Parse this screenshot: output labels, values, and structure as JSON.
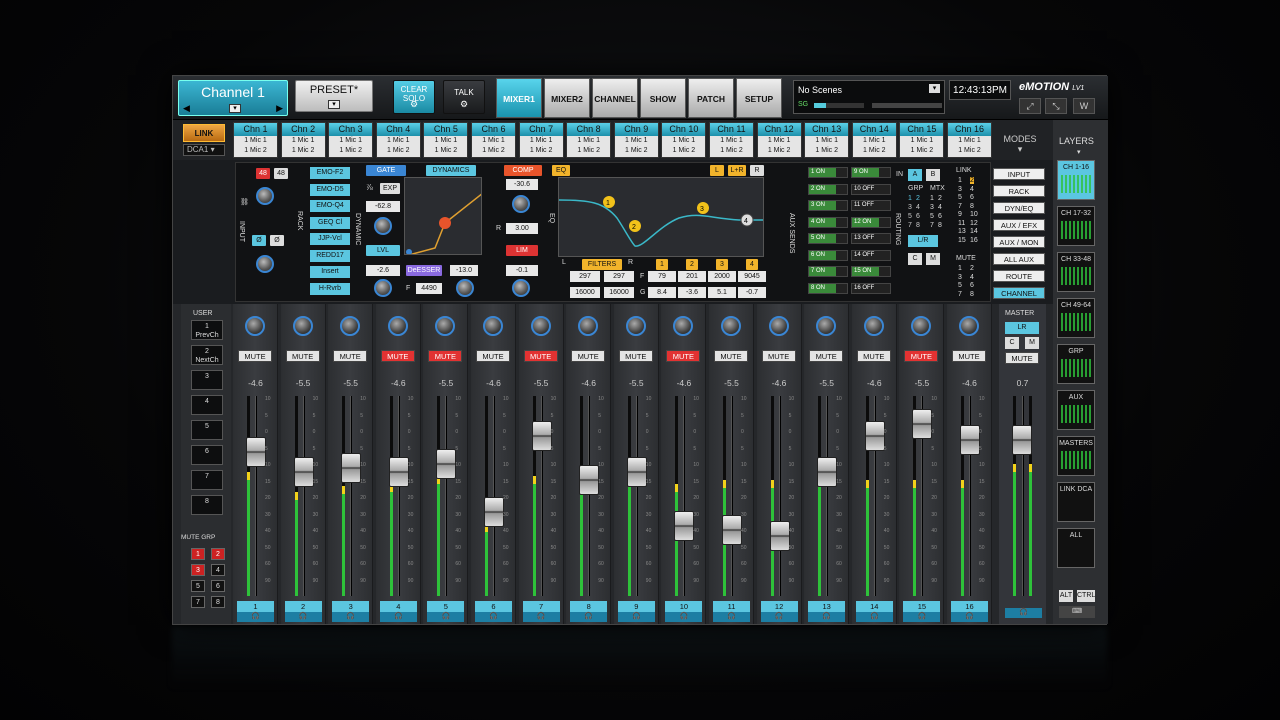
{
  "topbar": {
    "channel_name": "Channel 1",
    "preset": "PRESET*",
    "clear_solo": "CLEAR SOLO",
    "talk": "TALK",
    "tabs": [
      "MIXER1",
      "MIXER2",
      "CHANNEL",
      "SHOW",
      "PATCH",
      "SETUP"
    ],
    "scenes": "No Scenes",
    "sg": "SG",
    "clock": "12:43:13PM",
    "logo": "eMOTION",
    "logo_sub": "LV1"
  },
  "header": {
    "link": "LINK",
    "dca": "DCA1",
    "channels": [
      {
        "name": "Chn 1",
        "l1": "1 Mic 1",
        "l2": "1 Mic 2"
      },
      {
        "name": "Chn 2",
        "l1": "1 Mic 1",
        "l2": "1 Mic 2"
      },
      {
        "name": "Chn 3",
        "l1": "1 Mic 1",
        "l2": "1 Mic 2"
      },
      {
        "name": "Chn 4",
        "l1": "1 Mic 1",
        "l2": "1 Mic 2"
      },
      {
        "name": "Chn 5",
        "l1": "1 Mic 1",
        "l2": "1 Mic 2"
      },
      {
        "name": "Chn 6",
        "l1": "1 Mic 1",
        "l2": "1 Mic 2"
      },
      {
        "name": "Chn 7",
        "l1": "1 Mic 1",
        "l2": "1 Mic 2"
      },
      {
        "name": "Chn 8",
        "l1": "1 Mic 1",
        "l2": "1 Mic 2"
      },
      {
        "name": "Chn 9",
        "l1": "1 Mic 1",
        "l2": "1 Mic 2"
      },
      {
        "name": "Chn 10",
        "l1": "1 Mic 1",
        "l2": "1 Mic 2"
      },
      {
        "name": "Chn 11",
        "l1": "1 Mic 1",
        "l2": "1 Mic 2"
      },
      {
        "name": "Chn 12",
        "l1": "1 Mic 1",
        "l2": "1 Mic 2"
      },
      {
        "name": "Chn 13",
        "l1": "1 Mic 1",
        "l2": "1 Mic 2"
      },
      {
        "name": "Chn 14",
        "l1": "1 Mic 1",
        "l2": "1 Mic 2"
      },
      {
        "name": "Chn 15",
        "l1": "1 Mic 1",
        "l2": "1 Mic 2"
      },
      {
        "name": "Chn 16",
        "l1": "1 Mic 1",
        "l2": "1 Mic 2"
      }
    ],
    "modes": "MODES",
    "layers": "LAYERS"
  },
  "fx": {
    "input": "INPUT",
    "v48a": "48",
    "v48b": "48",
    "phase": "Ø",
    "rack": "RACK",
    "rack_items": [
      "EMO-F2",
      "EMO-D5",
      "EMO-Q4",
      "GEQ Cl",
      "JJP-Vcl",
      "REDD17",
      "Insert",
      "H-Rvrb"
    ],
    "gate": "GATE",
    "dynamics": "DYNAMICS",
    "comp": "COMP",
    "dynamic_label": "DYNAMIC",
    "exp": "EXP",
    "thr": "-62.8",
    "lvl": "LVL",
    "lvl_val": "-2.6",
    "deesser": "DeESSER",
    "de_val": "-13.0",
    "freq_label": "F",
    "freq_val": "4490",
    "comp_thr": "-30.6",
    "ratio_label": "R",
    "ratio": "3.00",
    "lim": "LIM",
    "lim_val": "-0.1",
    "eq": "EQ",
    "eq_label": "EQ",
    "l": "L",
    "lr": "L+R",
    "r": "R",
    "filters": "FILTERS",
    "fl": "L",
    "fr": "R",
    "hp": "297",
    "lp": "297",
    "hp2": "16000",
    "lp2": "16000",
    "fl_f": "F",
    "fl_g": "G",
    "bands": [
      {
        "n": "1",
        "f": "79",
        "g": "8.4"
      },
      {
        "n": "2",
        "f": "201",
        "g": "-3.6"
      },
      {
        "n": "3",
        "f": "2000",
        "g": "5.1"
      },
      {
        "n": "4",
        "f": "9045",
        "g": "-0.7"
      }
    ],
    "aux_sends": "AUX SENDS",
    "aux": [
      "1 ON",
      "2 ON",
      "3 ON",
      "4 ON",
      "5 ON",
      "6 ON",
      "7 ON",
      "8 ON",
      "9 ON",
      "10 OFF",
      "11 OFF",
      "12 ON",
      "13 OFF",
      "14 OFF",
      "15 ON",
      "16 OFF"
    ],
    "in": "IN",
    "a": "A",
    "b": "B",
    "link": "LINK",
    "grp": "GRP",
    "mtx": "MTX",
    "routing": "ROUTING",
    "lr_btn": "L/R",
    "c": "C",
    "m": "M",
    "mute": "MUTE",
    "grp_nums": [
      "1",
      "2",
      "3",
      "4",
      "5",
      "6",
      "7",
      "8"
    ],
    "mtx_nums": [
      "1",
      "2",
      "3",
      "4",
      "5",
      "6",
      "7",
      "8"
    ],
    "link_nums": [
      "1",
      "3",
      "5",
      "7",
      "9",
      "11",
      "13",
      "15"
    ],
    "link_nums2": [
      "2",
      "4",
      "6",
      "8",
      "10",
      "12",
      "14",
      "16"
    ],
    "mute_nums": [
      "1",
      "2",
      "3",
      "4",
      "5",
      "6",
      "7",
      "8"
    ]
  },
  "modes": [
    "INPUT",
    "RACK",
    "DYN/EQ",
    "AUX / EFX",
    "AUX / MON",
    "ALL AUX",
    "ROUTE",
    "CHANNEL"
  ],
  "user": {
    "title": "USER",
    "buttons": [
      {
        "n": "1",
        "t": "PrevCh"
      },
      {
        "n": "2",
        "t": "NextCh"
      },
      {
        "n": "3",
        "t": ""
      },
      {
        "n": "4",
        "t": ""
      },
      {
        "n": "5",
        "t": ""
      },
      {
        "n": "6",
        "t": ""
      },
      {
        "n": "7",
        "t": ""
      },
      {
        "n": "8",
        "t": ""
      }
    ],
    "mute_grp": "MUTE GRP",
    "mg": [
      "1",
      "2",
      "3",
      "4",
      "5",
      "6",
      "7",
      "8"
    ]
  },
  "strips": [
    {
      "n": "1",
      "db": "-4.6",
      "mute": false,
      "f": 0.72,
      "m": 0.62
    },
    {
      "n": "2",
      "db": "-5.5",
      "mute": false,
      "f": 0.62,
      "m": 0.52
    },
    {
      "n": "3",
      "db": "-5.5",
      "mute": false,
      "f": 0.64,
      "m": 0.55
    },
    {
      "n": "4",
      "db": "-4.6",
      "mute": true,
      "f": 0.62,
      "m": 0.56
    },
    {
      "n": "5",
      "db": "-5.5",
      "mute": true,
      "f": 0.66,
      "m": 0.6
    },
    {
      "n": "6",
      "db": "-4.6",
      "mute": false,
      "f": 0.42,
      "m": 0.36
    },
    {
      "n": "7",
      "db": "-5.5",
      "mute": true,
      "f": 0.8,
      "m": 0.6
    },
    {
      "n": "8",
      "db": "-4.6",
      "mute": false,
      "f": 0.58,
      "m": 0.55
    },
    {
      "n": "9",
      "db": "-5.5",
      "mute": false,
      "f": 0.62,
      "m": 0.6
    },
    {
      "n": "10",
      "db": "-4.6",
      "mute": true,
      "f": 0.35,
      "m": 0.56
    },
    {
      "n": "11",
      "db": "-5.5",
      "mute": false,
      "f": 0.33,
      "m": 0.58
    },
    {
      "n": "12",
      "db": "-4.6",
      "mute": false,
      "f": 0.3,
      "m": 0.58
    },
    {
      "n": "13",
      "db": "-5.5",
      "mute": false,
      "f": 0.62,
      "m": 0.6
    },
    {
      "n": "14",
      "db": "-4.6",
      "mute": false,
      "f": 0.8,
      "m": 0.58
    },
    {
      "n": "15",
      "db": "-5.5",
      "mute": true,
      "f": 0.86,
      "m": 0.58
    },
    {
      "n": "16",
      "db": "-4.6",
      "mute": false,
      "f": 0.78,
      "m": 0.58
    }
  ],
  "mute_label": "MUTE",
  "scale": [
    "10",
    "5",
    "0",
    "5",
    "10",
    "15",
    "20",
    "30",
    "40",
    "50",
    "60",
    "90"
  ],
  "master": {
    "title": "MASTER",
    "lr": "LR",
    "c": "C",
    "m": "M",
    "mute": "MUTE",
    "db": "0.7",
    "f": 0.78,
    "m_level": 0.66
  },
  "layers": [
    {
      "t": "CH 1-16",
      "on": true
    },
    {
      "t": "CH 17-32",
      "on": false
    },
    {
      "t": "CH 33-48",
      "on": false
    },
    {
      "t": "CH 49-64",
      "on": false
    },
    {
      "t": "GRP",
      "on": false
    },
    {
      "t": "AUX",
      "on": false
    },
    {
      "t": "MASTERS",
      "on": false
    },
    {
      "t": "LINK DCA",
      "on": false
    },
    {
      "t": "ALL",
      "on": false
    }
  ],
  "alt": "ALT",
  "ctrl": "CTRL",
  "colors": {
    "accent": "#5bc6e0",
    "mute_on": "#e23232",
    "link": "#f0a743",
    "meter": "#2ec23a"
  }
}
